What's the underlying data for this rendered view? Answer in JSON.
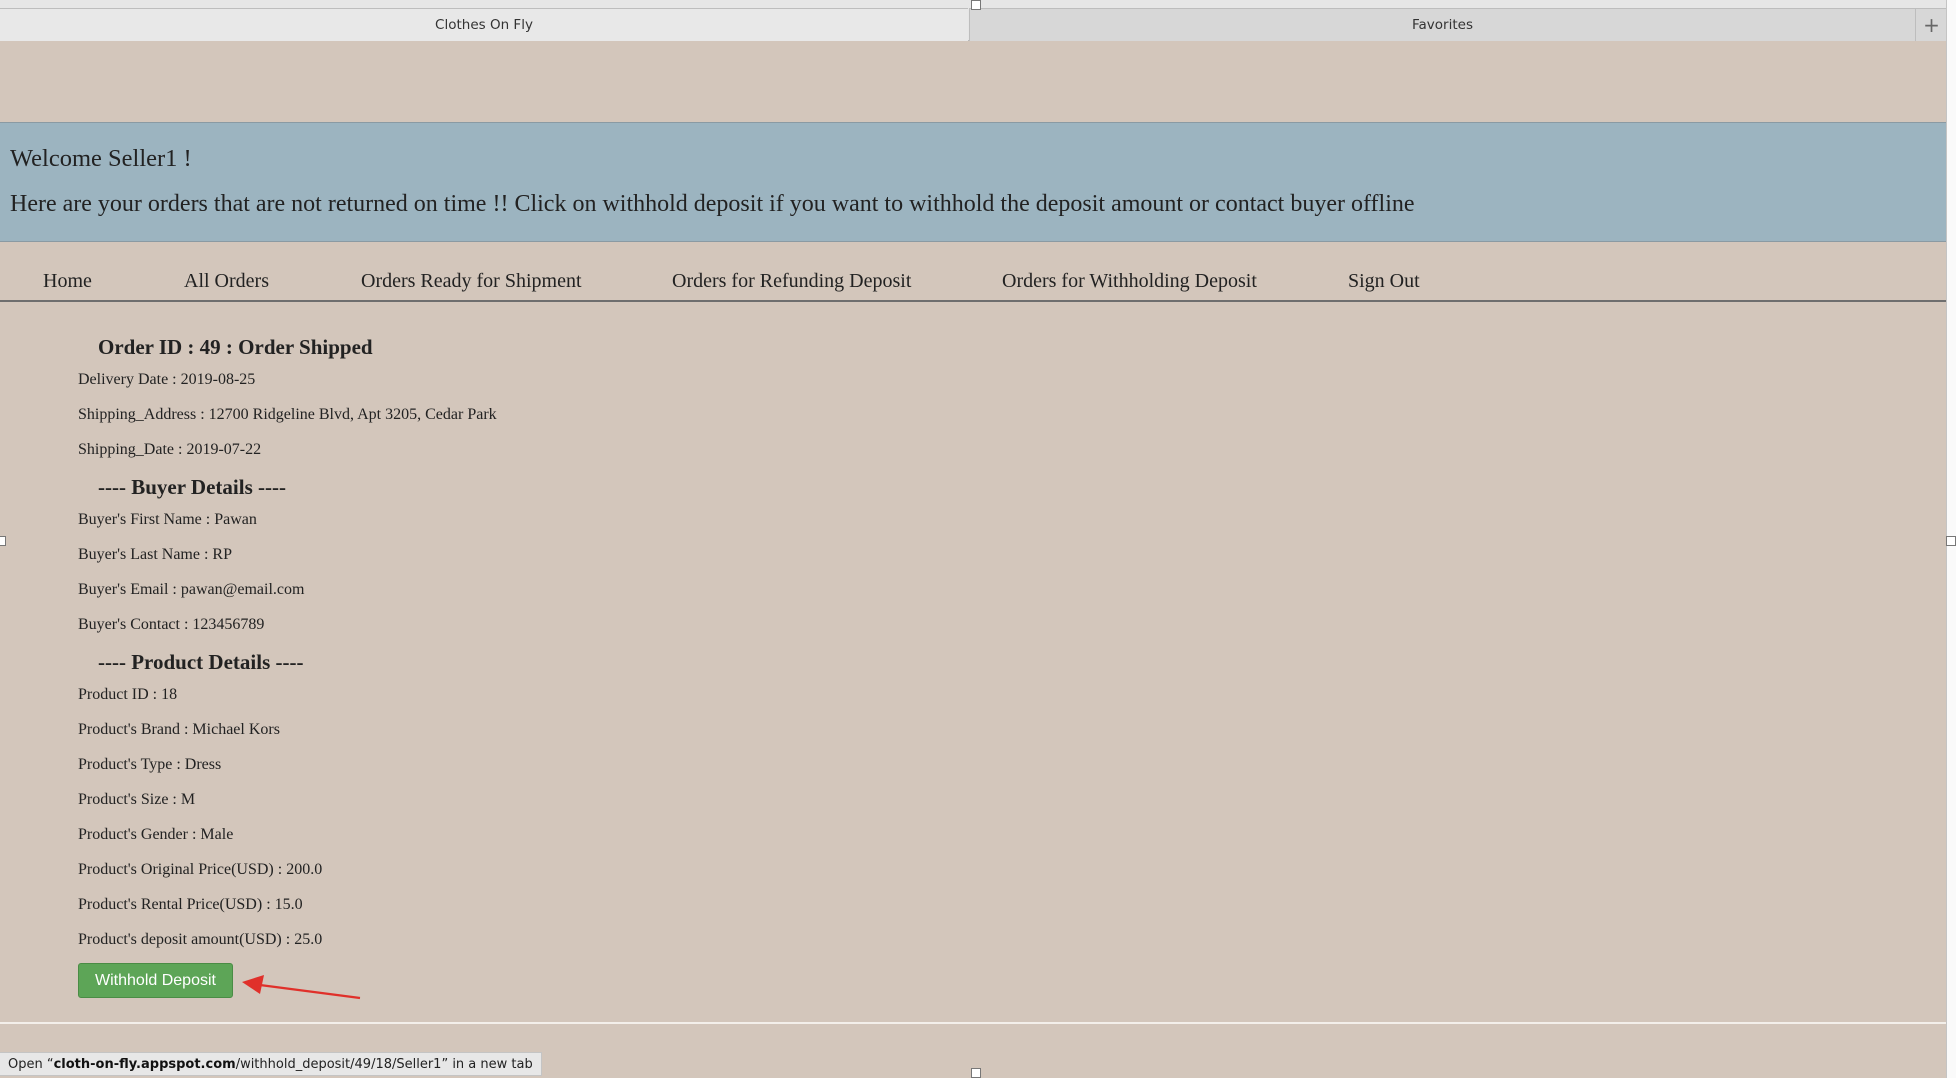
{
  "tabs": [
    {
      "label": "Clothes On Fly",
      "active": true
    },
    {
      "label": "Favorites",
      "active": false
    }
  ],
  "tab_add_label": "+",
  "banner": {
    "welcome": "Welcome Seller1 !",
    "notice": "Here are your orders that are not returned on time !! Click on withhold deposit if you want to withhold the deposit amount or contact buyer offline"
  },
  "nav": {
    "home": "Home",
    "all_orders": "All Orders",
    "ready_shipment": "Orders Ready for Shipment",
    "refunding": "Orders for Refunding Deposit",
    "withholding": "Orders for Withholding Deposit",
    "sign_out": "Sign Out"
  },
  "order": {
    "heading": "Order ID : 49 : Order Shipped",
    "delivery_date": "Delivery Date : 2019-08-25",
    "shipping_address": "Shipping_Address : 12700 Ridgeline Blvd, Apt 3205, Cedar Park",
    "shipping_date": "Shipping_Date : 2019-07-22",
    "buyer_heading": "---- Buyer Details ----",
    "buyer_first": "Buyer's First Name : Pawan",
    "buyer_last": "Buyer's Last Name : RP",
    "buyer_email": "Buyer's Email : pawan@email.com",
    "buyer_contact": "Buyer's Contact : 123456789",
    "product_heading": "---- Product Details ----",
    "product_id": "Product ID : 18",
    "product_brand": "Product's Brand : Michael Kors",
    "product_type": "Product's Type : Dress",
    "product_size": "Product's Size : M",
    "product_gender": "Product's Gender : Male",
    "original_price": "Product's Original Price(USD) : 200.0",
    "rental_price": "Product's Rental Price(USD) : 15.0",
    "deposit_amount": "Product's deposit amount(USD) : 25.0"
  },
  "withhold_button": "Withhold Deposit",
  "status_bar": {
    "prefix": "Open “",
    "domain": "cloth-on-fly.appspot.com",
    "path": "/withhold_deposit/49/18/Seller1",
    "suffix": "” in a new tab"
  },
  "colors": {
    "page_bg": "#d3c6bb",
    "banner_bg": "#9cb4c0",
    "button_bg": "#5da557",
    "arrow": "#e0302a"
  }
}
